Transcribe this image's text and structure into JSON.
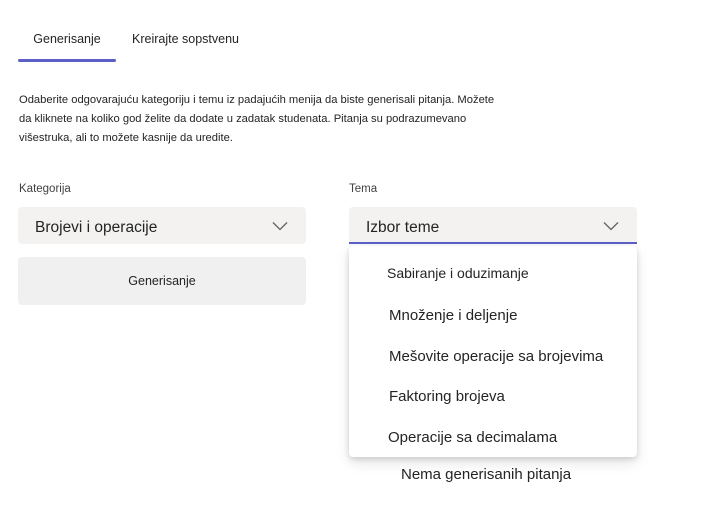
{
  "tabs": [
    {
      "label": "Generisanje",
      "selected": true
    },
    {
      "label": "Kreirajte sopstvenu",
      "selected": false
    }
  ],
  "description": "Odaberite odgovarajuću kategoriju i temu iz padajućih menija da biste generisali pitanja. Možete da kliknete na koliko god želite da dodate u zadatak studenata. Pitanja su podrazumevano višestruka, ali to možete kasnije da uredite.",
  "category": {
    "label": "Kategorija",
    "value": "Brojevi i operacije"
  },
  "topic": {
    "label": "Tema",
    "placeholder": "Izbor teme",
    "options": [
      "Sabiranje i oduzimanje",
      "Množenje i deljenje",
      "Mešovite operacije sa brojevima",
      "Faktoring brojeva",
      "Operacije sa decimalama"
    ]
  },
  "generate_button": "Generisanje",
  "empty_state": "Nema generisanih pitanja",
  "colors": {
    "accent": "#5b5fc7",
    "field_background": "#f3f2f1",
    "text": "#242424"
  },
  "icons": {
    "dropdown": "chevron-down-icon"
  }
}
